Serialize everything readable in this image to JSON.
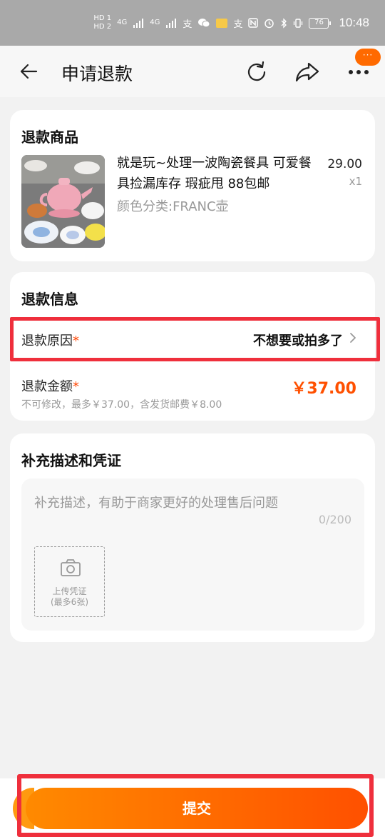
{
  "status_bar": {
    "hd1": "HD 1",
    "hd2": "HD 2",
    "net1": "4G",
    "net2": "4G",
    "alipay1": "支",
    "alipay2": "支",
    "battery": "76",
    "time": "10:48"
  },
  "header": {
    "title": "申请退款",
    "badge": "···",
    "icons": {
      "back": "back-arrow-icon",
      "refresh": "refresh-icon",
      "share": "share-icon",
      "more": "more-icon"
    }
  },
  "product_section": {
    "title": "退款商品",
    "item": {
      "name": "就是玩~处理一波陶瓷餐具 可爱餐具捡漏库存 瑕疵甩 88包邮",
      "variant": "颜色分类:FRANC壶",
      "price": "29.00",
      "quantity": "x1"
    }
  },
  "refund_info": {
    "title": "退款信息",
    "reason_label": "退款原因",
    "reason_value": "不想要或拍多了",
    "required_mark": "*",
    "amount_label": "退款金额",
    "amount_value": "￥37.00",
    "amount_note": "不可修改，最多￥37.00，含发货邮费￥8.00"
  },
  "description": {
    "title": "补充描述和凭证",
    "placeholder": "补充描述，有助于商家更好的处理售后问题",
    "char_count": "0/200",
    "upload_label_line1": "上传凭证",
    "upload_label_line2": "(最多6张)"
  },
  "footer": {
    "submit_label": "提交"
  },
  "colors": {
    "accent": "#ff5000",
    "highlight": "#ef2f3c"
  }
}
